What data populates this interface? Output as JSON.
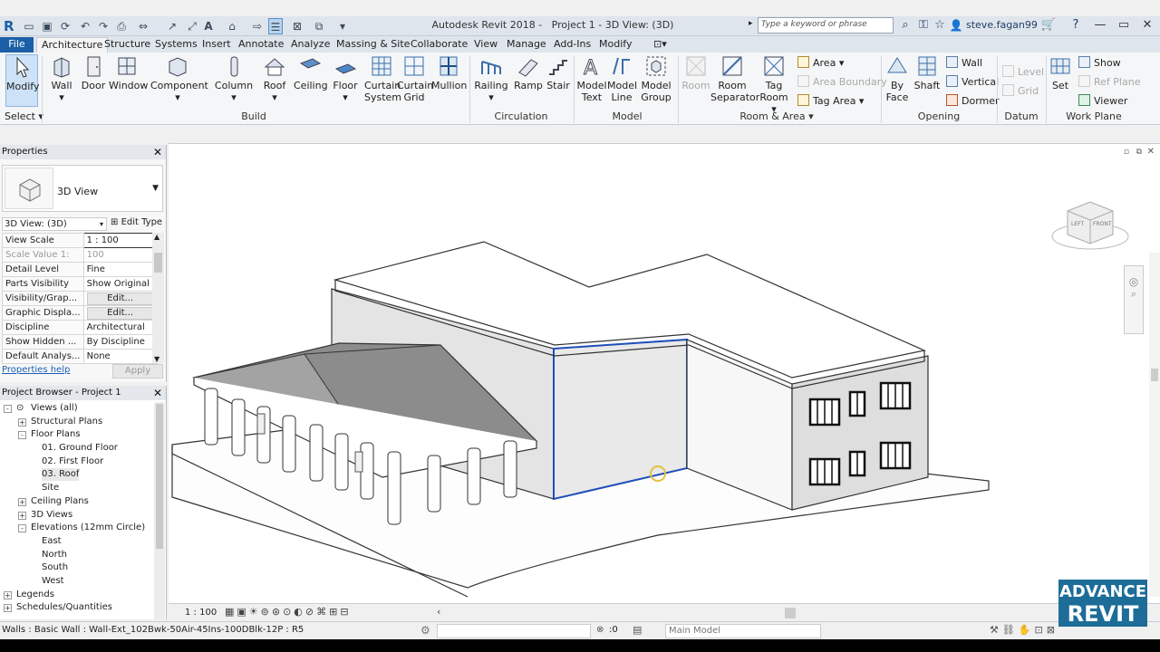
{
  "app": {
    "title": "Autodesk Revit 2018 -",
    "project_view": "Project 1 - 3D View: (3D)",
    "search_placeholder": "Type a keyword or phrase",
    "user": "steve.fagan99"
  },
  "tabs": [
    "File",
    "Architecture",
    "Structure",
    "Systems",
    "Insert",
    "Annotate",
    "Analyze",
    "Massing & Site",
    "Collaborate",
    "View",
    "Manage",
    "Add-Ins",
    "Modify"
  ],
  "ribbon": {
    "select": {
      "modify": "Modify",
      "select": "Select"
    },
    "build": {
      "label": "Build",
      "wall": "Wall",
      "door": "Door",
      "window": "Window",
      "component": "Component",
      "column": "Column",
      "roof": "Roof",
      "ceiling": "Ceiling",
      "floor": "Floor",
      "curtain_system": [
        "Curtain",
        "System"
      ],
      "curtain_grid": [
        "Curtain",
        "Grid"
      ],
      "mullion": "Mullion"
    },
    "circulation": {
      "label": "Circulation",
      "railing": "Railing",
      "ramp": "Ramp",
      "stair": "Stair"
    },
    "model": {
      "label": "Model",
      "model_text": [
        "Model",
        "Text"
      ],
      "model_line": [
        "Model",
        "Line"
      ],
      "model_group": [
        "Model",
        "Group"
      ]
    },
    "room_area": {
      "label": "Room & Area",
      "room": "Room",
      "room_separator": [
        "Room",
        "Separator"
      ],
      "tag_room": [
        "Tag",
        "Room"
      ],
      "area": "Area",
      "area_boundary": "Area  Boundary",
      "tag_area": "Tag  Area"
    },
    "opening": {
      "label": "Opening",
      "by_face": [
        "By",
        "Face"
      ],
      "shaft": "Shaft",
      "wall": "Wall",
      "vertical": "Vertical",
      "dormer": "Dormer"
    },
    "datum": {
      "label": "Datum",
      "level": "Level",
      "grid": "Grid"
    },
    "work_plane": {
      "label": "Work Plane",
      "set": "Set",
      "show": "Show",
      "ref_plane": "Ref  Plane",
      "viewer": "Viewer"
    }
  },
  "properties": {
    "title": "Properties",
    "type_name": "3D View",
    "view_selector": "3D View: (3D)",
    "edit_type": "Edit Type",
    "rows": [
      {
        "k": "View Scale",
        "v": "1 : 100"
      },
      {
        "k": "Scale Value   1:",
        "v": "100"
      },
      {
        "k": "Detail Level",
        "v": "Fine"
      },
      {
        "k": "Parts Visibility",
        "v": "Show Original"
      },
      {
        "k": "Visibility/Grap...",
        "v": "Edit..."
      },
      {
        "k": "Graphic Displa...",
        "v": "Edit..."
      },
      {
        "k": "Discipline",
        "v": "Architectural"
      },
      {
        "k": "Show Hidden ...",
        "v": "By Discipline"
      },
      {
        "k": "Default Analys...",
        "v": "None"
      }
    ],
    "help": "Properties help",
    "apply": "Apply"
  },
  "browser": {
    "title": "Project Browser - Project 1",
    "items": [
      {
        "label": "Views (all)",
        "indent": 0,
        "exp": "-"
      },
      {
        "label": "Structural Plans",
        "indent": 1,
        "exp": "+"
      },
      {
        "label": "Floor Plans",
        "indent": 1,
        "exp": "-"
      },
      {
        "label": "01. Ground Floor",
        "indent": 2,
        "exp": ""
      },
      {
        "label": "02. First Floor",
        "indent": 2,
        "exp": ""
      },
      {
        "label": "03. Roof",
        "indent": 2,
        "exp": ""
      },
      {
        "label": "Site",
        "indent": 2,
        "exp": ""
      },
      {
        "label": "Ceiling Plans",
        "indent": 1,
        "exp": "+"
      },
      {
        "label": "3D Views",
        "indent": 1,
        "exp": "+"
      },
      {
        "label": "Elevations (12mm Circle)",
        "indent": 1,
        "exp": "-"
      },
      {
        "label": "East",
        "indent": 2,
        "exp": ""
      },
      {
        "label": "North",
        "indent": 2,
        "exp": ""
      },
      {
        "label": "South",
        "indent": 2,
        "exp": ""
      },
      {
        "label": "West",
        "indent": 2,
        "exp": ""
      },
      {
        "label": "Legends",
        "indent": 0,
        "exp": "+"
      },
      {
        "label": "Schedules/Quantities",
        "indent": 0,
        "exp": "+"
      }
    ]
  },
  "viewbar": {
    "scale": "1 : 100"
  },
  "status": {
    "text": "Walls : Basic Wall : Wall-Ext_102Bwk-50Air-45Ins-100DBlk-12P : R5",
    "filter": ":0",
    "model": "Main Model"
  },
  "viewcube": {
    "left": "LEFT",
    "front": "FRONT"
  },
  "badge": {
    "line1": "ADVANCE",
    "line2": "REVIT"
  }
}
